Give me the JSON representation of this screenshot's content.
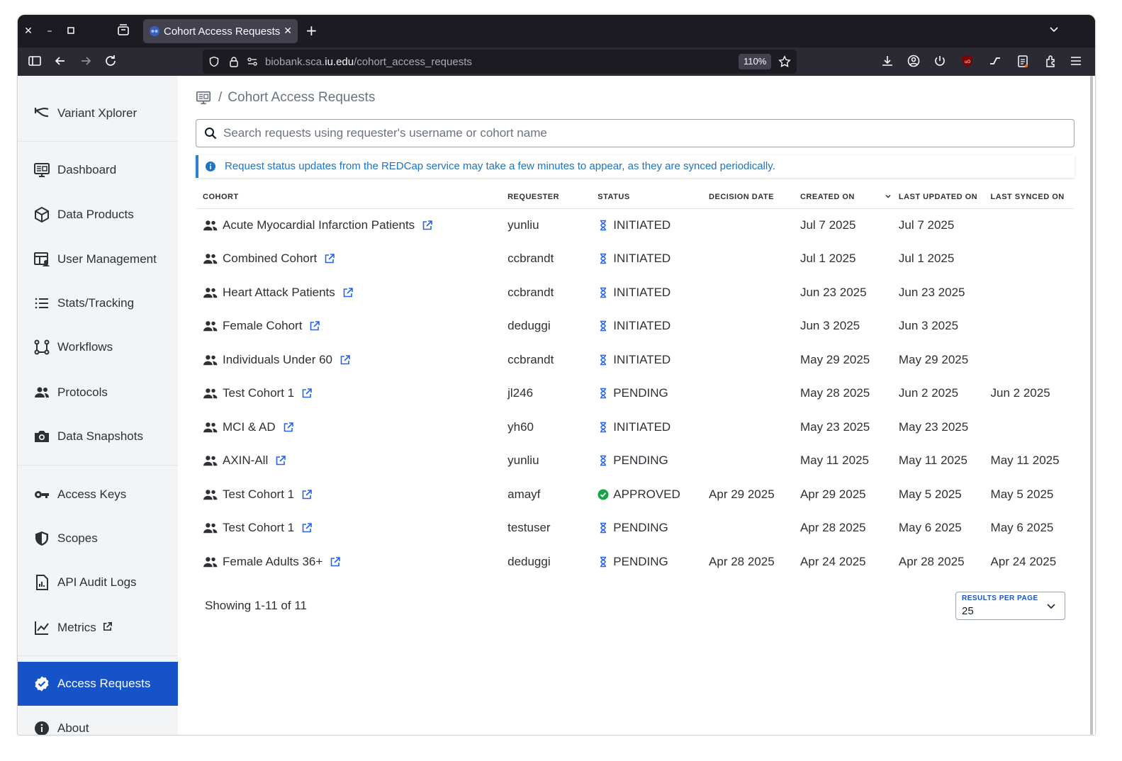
{
  "browser": {
    "tab_title": "Cohort Access Requests | Variant Xplorer",
    "url_prefix": "biobank.sca.",
    "url_domain": "iu.edu",
    "url_path": "/cohort_access_requests",
    "zoom": "110%"
  },
  "sidebar": {
    "brand": "Variant Xplorer",
    "items": [
      {
        "label": "Dashboard",
        "icon": "monitor-icon"
      },
      {
        "label": "Data Products",
        "icon": "cube-icon"
      },
      {
        "label": "User Management",
        "icon": "table-user-icon"
      },
      {
        "label": "Stats/Tracking",
        "icon": "list-icon"
      },
      {
        "label": "Workflows",
        "icon": "workflow-icon"
      },
      {
        "label": "Protocols",
        "icon": "people-icon"
      },
      {
        "label": "Data Snapshots",
        "icon": "camera-icon"
      },
      {
        "label": "Access Keys",
        "icon": "key-icon"
      },
      {
        "label": "Scopes",
        "icon": "shield-icon"
      },
      {
        "label": "API Audit Logs",
        "icon": "report-icon"
      },
      {
        "label": "Metrics",
        "icon": "chart-icon"
      },
      {
        "label": "Access Requests",
        "icon": "verified-icon"
      },
      {
        "label": "About",
        "icon": "info-icon"
      }
    ],
    "active": "Access Requests"
  },
  "breadcrumb": {
    "separator": "/",
    "current": "Cohort Access Requests"
  },
  "search": {
    "placeholder": "Search requests using requester's username or cohort name",
    "value": ""
  },
  "banner": {
    "text": "Request status updates from the REDCap service may take a few minutes to appear, as they are synced periodically."
  },
  "table": {
    "headers": {
      "cohort": "COHORT",
      "requester": "REQUESTER",
      "status": "STATUS",
      "decision_date": "DECISION DATE",
      "created_on": "CREATED ON",
      "last_updated_on": "LAST UPDATED ON",
      "last_synced_on": "LAST SYNCED ON"
    },
    "rows": [
      {
        "cohort": "Acute Myocardial Infarction Patients",
        "requester": "yunliu",
        "status": "INITIATED",
        "decision": "",
        "created": "Jul 7 2025",
        "updated": "Jul 7 2025",
        "synced": ""
      },
      {
        "cohort": "Combined Cohort",
        "requester": "ccbrandt",
        "status": "INITIATED",
        "decision": "",
        "created": "Jul 1 2025",
        "updated": "Jul 1 2025",
        "synced": ""
      },
      {
        "cohort": "Heart Attack Patients",
        "requester": "ccbrandt",
        "status": "INITIATED",
        "decision": "",
        "created": "Jun 23 2025",
        "updated": "Jun 23 2025",
        "synced": ""
      },
      {
        "cohort": "Female Cohort",
        "requester": "deduggi",
        "status": "INITIATED",
        "decision": "",
        "created": "Jun 3 2025",
        "updated": "Jun 3 2025",
        "synced": ""
      },
      {
        "cohort": "Individuals Under 60",
        "requester": "ccbrandt",
        "status": "INITIATED",
        "decision": "",
        "created": "May 29 2025",
        "updated": "May 29 2025",
        "synced": ""
      },
      {
        "cohort": "Test Cohort 1",
        "requester": "jl246",
        "status": "PENDING",
        "decision": "",
        "created": "May 28 2025",
        "updated": "Jun 2 2025",
        "synced": "Jun 2 2025"
      },
      {
        "cohort": "MCI & AD",
        "requester": "yh60",
        "status": "INITIATED",
        "decision": "",
        "created": "May 23 2025",
        "updated": "May 23 2025",
        "synced": ""
      },
      {
        "cohort": "AXIN-All",
        "requester": "yunliu",
        "status": "PENDING",
        "decision": "",
        "created": "May 11 2025",
        "updated": "May 11 2025",
        "synced": "May 11 2025"
      },
      {
        "cohort": "Test Cohort 1",
        "requester": "amayf",
        "status": "APPROVED",
        "decision": "Apr 29 2025",
        "created": "Apr 29 2025",
        "updated": "May 5 2025",
        "synced": "May 5 2025"
      },
      {
        "cohort": "Test Cohort 1",
        "requester": "testuser",
        "status": "PENDING",
        "decision": "",
        "created": "Apr 28 2025",
        "updated": "May 6 2025",
        "synced": "May 6 2025"
      },
      {
        "cohort": "Female Adults 36+",
        "requester": "deduggi",
        "status": "PENDING",
        "decision": "Apr 28 2025",
        "created": "Apr 24 2025",
        "updated": "Apr 28 2025",
        "synced": "Apr 24 2025"
      }
    ]
  },
  "pagination": {
    "showing": "Showing 1-11 of 11",
    "results_per_page_label": "RESULTS PER PAGE",
    "results_per_page_value": "25"
  },
  "colors": {
    "accent": "#1753c8",
    "status_pending": "#2563eb",
    "status_approved": "#16a34a",
    "banner": "#1f74c4"
  }
}
